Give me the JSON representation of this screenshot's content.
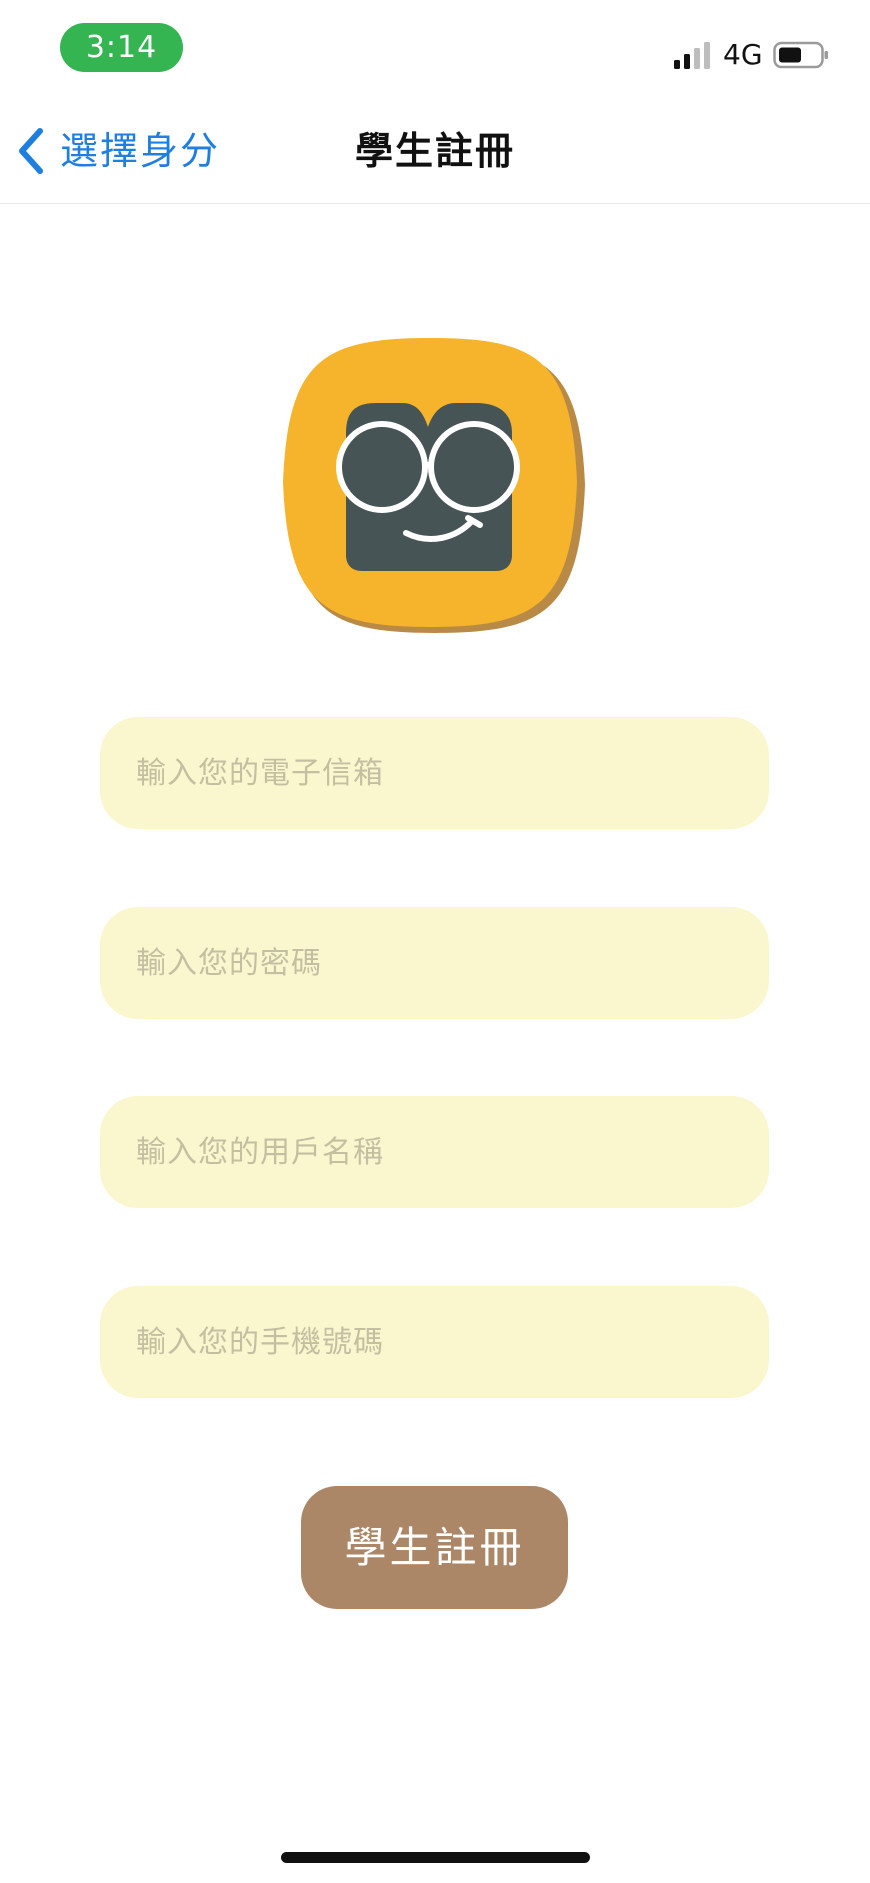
{
  "status_bar": {
    "time": "3:14",
    "network": "4G",
    "signal_icon": "signal-bars-icon",
    "battery_icon": "battery-icon",
    "time_pill_color": "#34b552"
  },
  "nav": {
    "back_label": "選擇身分",
    "back_icon": "chevron-left-icon",
    "title": "學生註冊",
    "accent_color": "#1f7fe0"
  },
  "logo": {
    "icon": "student-glasses-mascot-icon",
    "background_color": "#f6b32c",
    "face_color": "#465455"
  },
  "form": {
    "email_placeholder": "輸入您的電子信箱",
    "password_placeholder": "輸入您的密碼",
    "username_placeholder": "輸入您的用戶名稱",
    "phone_placeholder": "輸入您的手機號碼",
    "field_color": "#faf7cf"
  },
  "register_button": {
    "label": "學生註冊",
    "color": "#ac8767"
  }
}
